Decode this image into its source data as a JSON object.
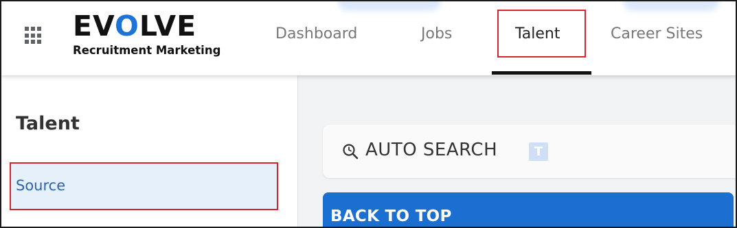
{
  "header": {
    "logo": {
      "word_before": "EV",
      "word_o": "O",
      "word_after": "LVE",
      "subtitle": "Recruitment Marketing"
    },
    "apps_icon": "grid-apps-icon",
    "nav": {
      "items": [
        {
          "label": "Dashboard",
          "active": false
        },
        {
          "label": "Jobs",
          "active": false
        },
        {
          "label": "Talent",
          "active": true
        },
        {
          "label": "Career Sites",
          "active": false
        }
      ]
    }
  },
  "sidebar": {
    "title": "Talent",
    "items": [
      {
        "label": "Source",
        "selected": true
      }
    ]
  },
  "main": {
    "auto_search": {
      "icon": "search-icon",
      "label": "AUTO SEARCH",
      "badge": "T"
    },
    "back_to_top": {
      "label": "BACK TO TOP"
    }
  },
  "colors": {
    "brand_blue": "#1e73d6",
    "nav_text": "#777777",
    "active_nav_text": "#222222",
    "highlight_red": "#d9232a",
    "sidebar_selected_bg": "#e6f0fa",
    "sidebar_selected_text": "#2a64b0",
    "back_to_top_bg": "#1b6fd1",
    "main_bg": "#f2f3f5"
  }
}
